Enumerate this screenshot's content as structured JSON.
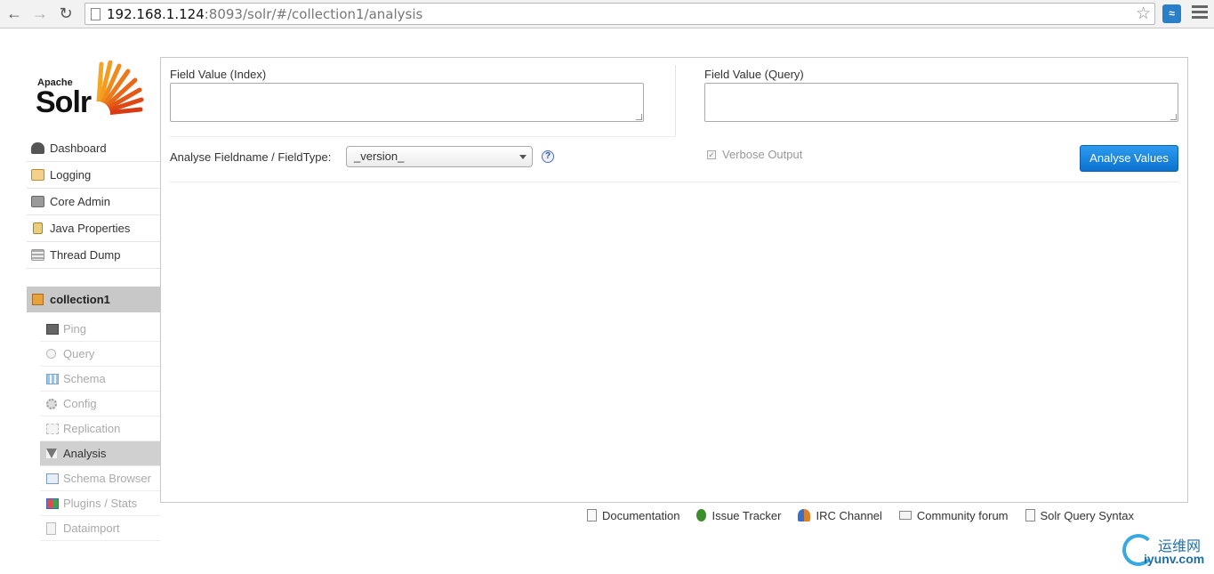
{
  "browser": {
    "url_host": "192.168.1.124",
    "url_rest": ":8093/solr/#/collection1/analysis"
  },
  "logo": {
    "apache": "Apache",
    "solr": "Solr"
  },
  "sidebar": {
    "items": [
      {
        "label": "Dashboard",
        "icon": "dashboard-icon",
        "color": "#555555"
      },
      {
        "label": "Logging",
        "icon": "logging-icon",
        "color": "#d98e3a"
      },
      {
        "label": "Core Admin",
        "icon": "core-admin-icon",
        "color": "#777777"
      },
      {
        "label": "Java Properties",
        "icon": "java-properties-icon",
        "color": "#c9a34a"
      },
      {
        "label": "Thread Dump",
        "icon": "thread-dump-icon",
        "color": "#999999"
      }
    ],
    "core": {
      "name": "collection1",
      "items": [
        {
          "label": "Ping"
        },
        {
          "label": "Query"
        },
        {
          "label": "Schema"
        },
        {
          "label": "Config"
        },
        {
          "label": "Replication"
        },
        {
          "label": "Analysis",
          "active": true
        },
        {
          "label": "Schema Browser"
        },
        {
          "label": "Plugins / Stats"
        },
        {
          "label": "Dataimport"
        }
      ]
    }
  },
  "main": {
    "index_label": "Field Value (Index)",
    "index_value": "",
    "query_label": "Field Value (Query)",
    "query_value": "",
    "fieldname_label": "Analyse Fieldname / FieldType:",
    "fieldname_selected": "_version_",
    "help_glyph": "?",
    "verbose_label": "Verbose Output",
    "verbose_checked": true,
    "analyse_button": "Analyse Values"
  },
  "footer": {
    "items": [
      {
        "label": "Documentation",
        "icon": "documentation-icon"
      },
      {
        "label": "Issue Tracker",
        "icon": "bug-icon"
      },
      {
        "label": "IRC Channel",
        "icon": "irc-channel-icon"
      },
      {
        "label": "Community forum",
        "icon": "mail-icon"
      },
      {
        "label": "Solr Query Syntax",
        "icon": "query-syntax-icon"
      }
    ]
  },
  "watermark": {
    "cn": "运维网",
    "en": "iyunv.com"
  },
  "colors": {
    "accent": "#0b72cf",
    "active_nav": "#d0d0d0",
    "core_header": "#c8c8c8"
  }
}
